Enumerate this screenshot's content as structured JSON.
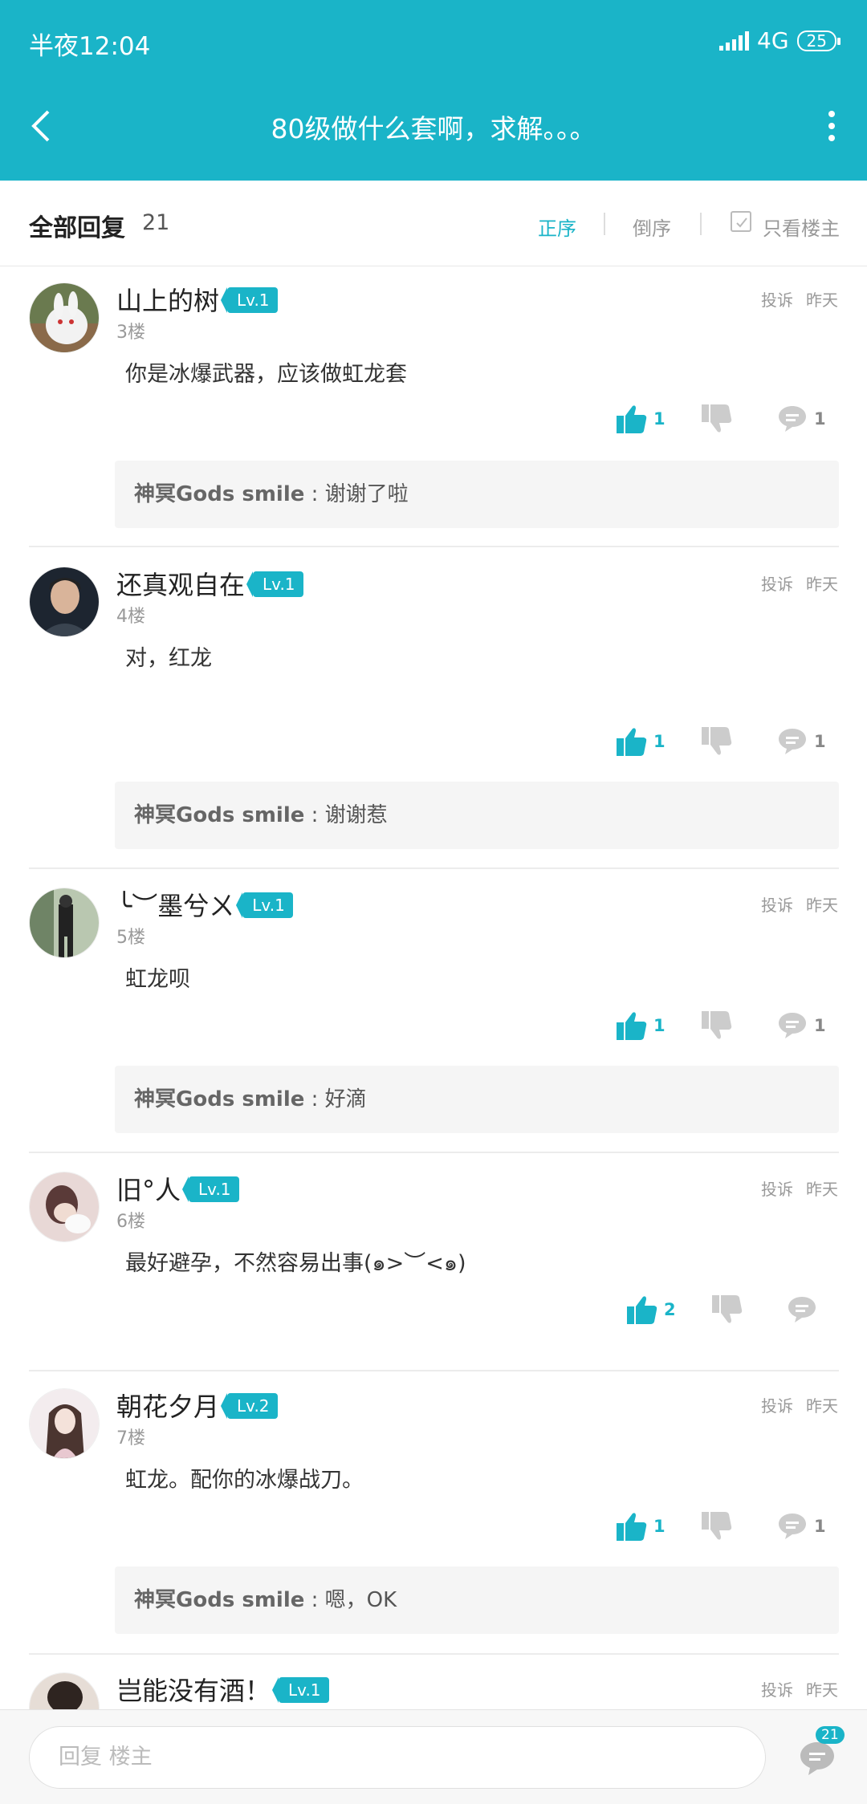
{
  "status": {
    "time": "半夜12:04",
    "network": "4G",
    "battery": "25"
  },
  "nav": {
    "title": "80级做什么套啊，求解。。。"
  },
  "filter": {
    "title": "全部回复",
    "count": "21",
    "sort_asc": "正序",
    "sort_desc": "倒序",
    "only_op": "只看楼主"
  },
  "posts": [
    {
      "user": "山上的树",
      "level": "Lv.1",
      "floor": "3楼",
      "report": "投诉",
      "time": "昨天",
      "content": "你是冰爆武器，应该做虹龙套",
      "likes": "1",
      "comments": "1",
      "reply_user": "神冥Gods smile",
      "reply_text": " : 谢谢了啦"
    },
    {
      "user": "还真观自在",
      "level": "Lv.1",
      "floor": "4楼",
      "report": "投诉",
      "time": "昨天",
      "content": "对，红龙",
      "likes": "1",
      "comments": "1",
      "reply_user": "神冥Gods smile",
      "reply_text": " : 谢谢惹"
    },
    {
      "user": "╰︶墨兮ㄨ",
      "level": "Lv.1",
      "floor": "5楼",
      "report": "投诉",
      "time": "昨天",
      "content": "虹龙呗",
      "likes": "1",
      "comments": "1",
      "reply_user": "神冥Gods smile",
      "reply_text": " : 好滴"
    },
    {
      "user": "旧°人",
      "level": "Lv.1",
      "floor": "6楼",
      "report": "投诉",
      "time": "昨天",
      "content": "最好避孕，不然容易出事(๑>︶<๑)",
      "likes": "2",
      "comments": ""
    },
    {
      "user": "朝花夕月",
      "level": "Lv.2",
      "floor": "7楼",
      "report": "投诉",
      "time": "昨天",
      "content": "虹龙。配你的冰爆战刀。",
      "likes": "1",
      "comments": "1",
      "reply_user": "神冥Gods smile",
      "reply_text": " : 嗯，OK"
    },
    {
      "user": "岂能没有酒！",
      "level": "Lv.1",
      "report": "投诉",
      "time": "昨天"
    }
  ],
  "bottom": {
    "placeholder": "回复  楼主",
    "comment_count": "21"
  },
  "colors": {
    "accent": "#1ab4c8",
    "background": "#ffffff"
  }
}
